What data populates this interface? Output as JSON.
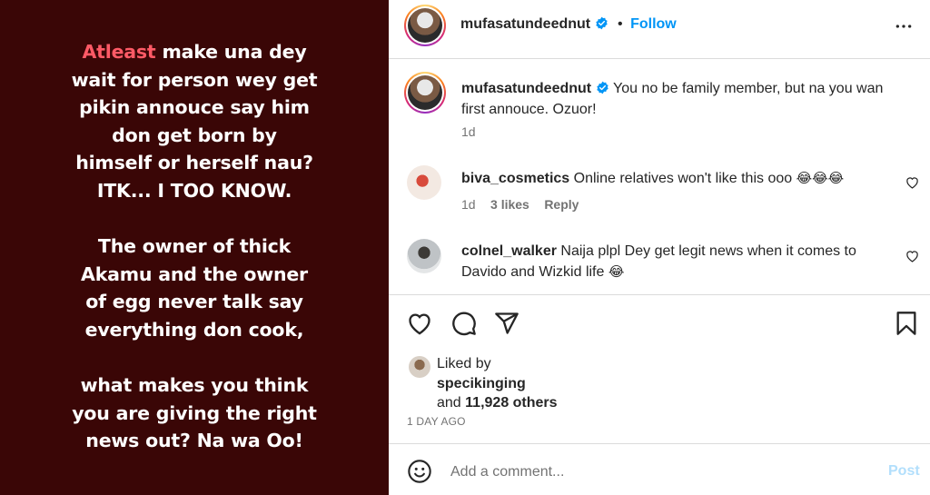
{
  "story": {
    "highlight": "Atleast",
    "line1_rest": " make una dey",
    "lines_a": [
      "wait for person wey get",
      "pikin annouce say him",
      "don get born by",
      "himself or herself nau?",
      "ITK... I TOO KNOW."
    ],
    "lines_b": [
      "The owner of thick",
      "Akamu and the owner",
      "of egg never talk say",
      "everything don cook,"
    ],
    "lines_c": [
      "what makes you think",
      "you are giving the right",
      "news out? Na wa Oo!"
    ]
  },
  "header": {
    "username": "mufasatundeednut",
    "dot": "•",
    "follow_label": "Follow"
  },
  "caption": {
    "username": "mufasatundeednut",
    "text": "You no be family member, but na you wan first annouce. Ozuor!",
    "time": "1d"
  },
  "comments": [
    {
      "username": "biva_cosmetics",
      "text": "Online relatives won't like this ooo",
      "emoji": "😂😂😂",
      "time": "1d",
      "likes": "3 likes",
      "reply": "Reply"
    },
    {
      "username": "colnel_walker",
      "text": "Naija plpl Dey get legit news when it comes to Davido and Wizkid life",
      "emoji": "😂"
    }
  ],
  "likes": {
    "prefix": "Liked by",
    "user": "specikinging",
    "and": "and",
    "count": "11,928 others",
    "date": "1 DAY AGO"
  },
  "composer": {
    "placeholder": "Add a comment...",
    "post_label": "Post"
  },
  "colors": {
    "accent": "#0095f6",
    "story_bg": "#3a0606",
    "highlight": "#ff5a66"
  },
  "icons": [
    "verified-badge-icon",
    "more-options-icon",
    "heart-icon",
    "comment-icon",
    "share-icon",
    "bookmark-icon",
    "emoji-icon"
  ]
}
